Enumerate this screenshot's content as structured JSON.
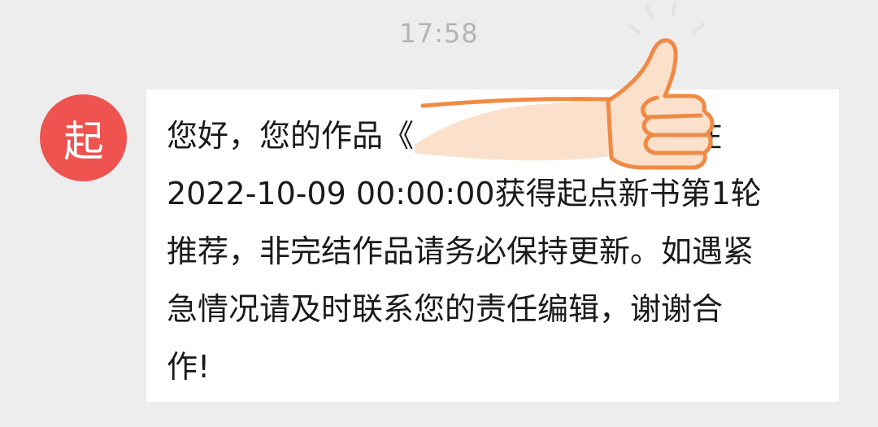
{
  "chat": {
    "timestamp": "17:58",
    "sender": {
      "avatar_text": "起",
      "avatar_color": "#ee5350",
      "avatar_icon": "qidian-logo-icon"
    },
    "message": {
      "lines": [
        "您好，您的作品《                      》将在",
        "2022-10-09 00:00:00获得起点新书第1轮",
        "推荐，非完结作品请务必保持更新。如遇紧",
        "急情况请及时联系您的责任编辑，谢谢合",
        "作!"
      ]
    },
    "overlay_sticker": "thumbs-up-icon"
  }
}
